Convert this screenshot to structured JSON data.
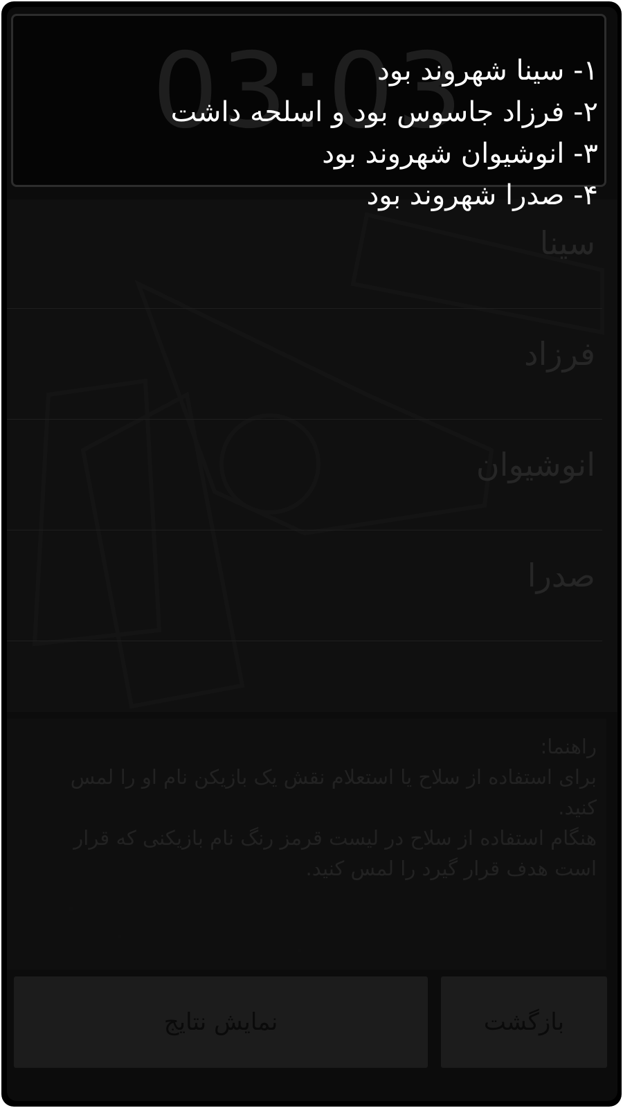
{
  "timer": {
    "value": "03:03"
  },
  "players": [
    {
      "name": "سینا"
    },
    {
      "name": "فرزاد"
    },
    {
      "name": "انوشیوان"
    },
    {
      "name": "صدرا"
    }
  ],
  "help": {
    "title": "راهنما:",
    "line1": "برای استفاده از سلاح یا استعلام نقش یک بازیکن نام او را لمس کنید.",
    "line2": "هنگام استفاده از سلاح در لیست قرمز رنگ نام بازیکنی که قرار است هدف قرار گیرد را لمس کنید."
  },
  "buttons": {
    "show_results": "نمایش نتایج",
    "back": "بازگشت"
  },
  "results": [
    "۱-  سینا شهروند بود",
    "۲- فرزاد  جاسوس بود و اسلحه داشت",
    "۳- انوشیوان شهروند بود",
    "۴- صدرا شهروند بود"
  ]
}
